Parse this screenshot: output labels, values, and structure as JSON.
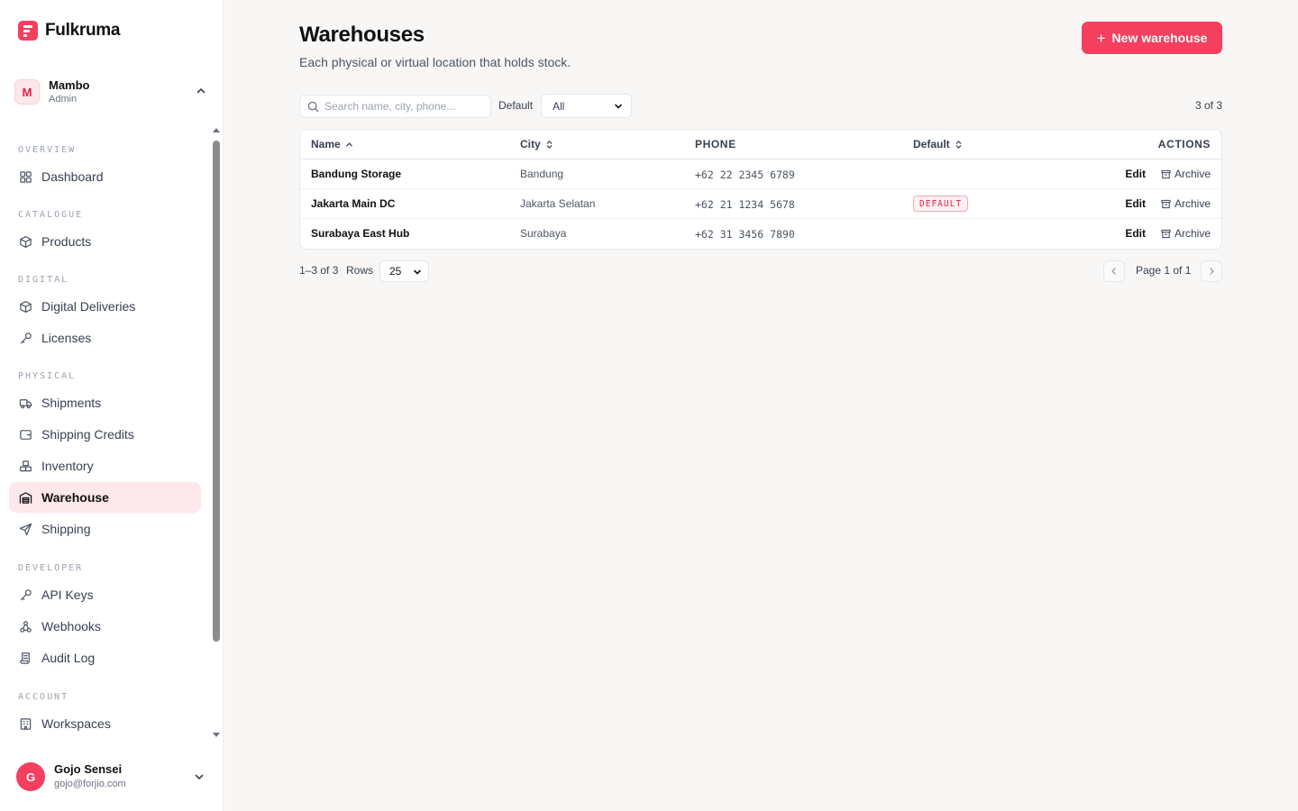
{
  "app": {
    "name": "Fulkruma"
  },
  "workspace": {
    "initial": "M",
    "name": "Mambo",
    "role": "Admin"
  },
  "nav": {
    "sections": [
      {
        "title": "OVERVIEW",
        "items": [
          {
            "label": "Dashboard",
            "icon": "dashboard-icon"
          }
        ]
      },
      {
        "title": "CATALOGUE",
        "items": [
          {
            "label": "Products",
            "icon": "package-icon"
          }
        ]
      },
      {
        "title": "DIGITAL",
        "items": [
          {
            "label": "Digital Deliveries",
            "icon": "package-icon"
          },
          {
            "label": "Licenses",
            "icon": "key-icon"
          }
        ]
      },
      {
        "title": "PHYSICAL",
        "items": [
          {
            "label": "Shipments",
            "icon": "truck-icon"
          },
          {
            "label": "Shipping Credits",
            "icon": "wallet-icon"
          },
          {
            "label": "Inventory",
            "icon": "boxes-icon"
          },
          {
            "label": "Warehouse",
            "icon": "warehouse-icon",
            "active": true
          },
          {
            "label": "Shipping",
            "icon": "send-icon"
          }
        ]
      },
      {
        "title": "DEVELOPER",
        "items": [
          {
            "label": "API Keys",
            "icon": "key-icon"
          },
          {
            "label": "Webhooks",
            "icon": "webhook-icon"
          },
          {
            "label": "Audit Log",
            "icon": "scroll-icon"
          }
        ]
      },
      {
        "title": "ACCOUNT",
        "items": [
          {
            "label": "Workspaces",
            "icon": "building-icon"
          }
        ]
      }
    ]
  },
  "user": {
    "initial": "G",
    "name": "Gojo Sensei",
    "email": "gojo@forjio.com"
  },
  "page": {
    "title": "Warehouses",
    "subtitle": "Each physical or virtual location that holds stock.",
    "new_button": "New warehouse"
  },
  "toolbar": {
    "search_placeholder": "Search name, city, phone...",
    "filter_label": "Default",
    "filter_value": "All",
    "count": "3 of 3"
  },
  "table": {
    "columns": {
      "name": "Name",
      "city": "City",
      "phone": "PHONE",
      "default": "Default",
      "actions": "ACTIONS"
    },
    "edit_label": "Edit",
    "archive_label": "Archive",
    "rows": [
      {
        "name": "Bandung Storage",
        "city": "Bandung",
        "phone": "+62 22 2345 6789",
        "default": ""
      },
      {
        "name": "Jakarta Main DC",
        "city": "Jakarta Selatan",
        "phone": "+62 21 1234 5678",
        "default": "DEFAULT"
      },
      {
        "name": "Surabaya East Hub",
        "city": "Surabaya",
        "phone": "+62 31 3456 7890",
        "default": ""
      }
    ]
  },
  "pagination": {
    "range": "1–3 of 3",
    "rows_label": "Rows",
    "rows_value": "25",
    "page_text": "Page 1 of 1"
  },
  "colors": {
    "accent": "#f43f5e",
    "active_bg": "#fde8ec"
  }
}
